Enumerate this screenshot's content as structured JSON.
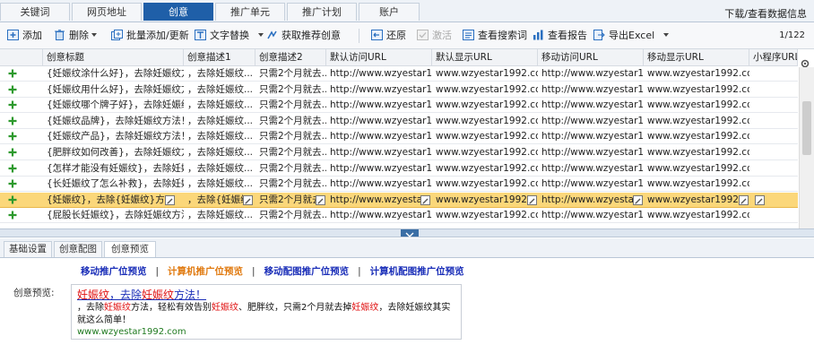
{
  "tabs": [
    "关键词",
    "网页地址",
    "创意",
    "推广单元",
    "推广计划",
    "账户"
  ],
  "active_tab": "创意",
  "top_right": "下载/查看数据信息",
  "toolbar": {
    "add": "添加",
    "delete": "删除",
    "batch": "批量添加/更新",
    "replace": "文字替换",
    "recommend": "获取推荐创意",
    "restore": "还原",
    "activate": "激活",
    "view_search": "查看搜索词",
    "view_report": "查看报告",
    "export": "导出Excel",
    "pager": "1/122"
  },
  "columns": [
    "创意标题",
    "创意描述1",
    "创意描述2",
    "默认访问URL",
    "默认显示URL",
    "移动访问URL",
    "移动显示URL",
    "小程序URL"
  ],
  "rows": [
    {
      "title": "{妊娠纹涂什么好}，去除妊娠纹方...",
      "d1": "，去除妊娠纹...",
      "d2": "只需2个月就去...",
      "u1": "http://www.wzyestar19...",
      "u2": "www.wzyestar1992.com",
      "u3": "http://www.wzyestar19...",
      "u4": "www.wzyestar1992.com"
    },
    {
      "title": "{妊娠纹用什么好}，去除妊娠纹方...",
      "d1": "，去除妊娠纹...",
      "d2": "只需2个月就去...",
      "u1": "http://www.wzyestar19...",
      "u2": "www.wzyestar1992.com",
      "u3": "http://www.wzyestar19...",
      "u4": "www.wzyestar1992.com"
    },
    {
      "title": "{妊娠纹哪个牌子好}，去除妊娠纹...",
      "d1": "，去除妊娠纹...",
      "d2": "只需2个月就去...",
      "u1": "http://www.wzyestar19...",
      "u2": "www.wzyestar1992.com",
      "u3": "http://www.wzyestar19...",
      "u4": "www.wzyestar1992.com"
    },
    {
      "title": "{妊娠纹品牌}，去除妊娠纹方法！",
      "d1": "，去除妊娠纹...",
      "d2": "只需2个月就去...",
      "u1": "http://www.wzyestar19...",
      "u2": "www.wzyestar1992.com",
      "u3": "http://www.wzyestar19...",
      "u4": "www.wzyestar1992.com"
    },
    {
      "title": "{妊娠纹产品}，去除妊娠纹方法！",
      "d1": "，去除妊娠纹...",
      "d2": "只需2个月就去...",
      "u1": "http://www.wzyestar19...",
      "u2": "www.wzyestar1992.com",
      "u3": "http://www.wzyestar19...",
      "u4": "www.wzyestar1992.com"
    },
    {
      "title": "{肥胖纹如何改善}，去除妊娠纹方...",
      "d1": "，去除妊娠纹...",
      "d2": "只需2个月就去...",
      "u1": "http://www.wzyestar19...",
      "u2": "www.wzyestar1992.com",
      "u3": "http://www.wzyestar19...",
      "u4": "www.wzyestar1992.com"
    },
    {
      "title": "{怎样才能没有妊娠纹}，去除妊娠...",
      "d1": "，去除妊娠纹...",
      "d2": "只需2个月就去...",
      "u1": "http://www.wzyestar19...",
      "u2": "www.wzyestar1992.com",
      "u3": "http://www.wzyestar19...",
      "u4": "www.wzyestar1992.com"
    },
    {
      "title": "{长妊娠纹了怎么补救}，去除妊娠...",
      "d1": "，去除妊娠纹...",
      "d2": "只需2个月就去...",
      "u1": "http://www.wzyestar19...",
      "u2": "www.wzyestar1992.com",
      "u3": "http://www.wzyestar19...",
      "u4": "www.wzyestar1992.com"
    },
    {
      "title": "{妊娠纹}，去除{妊娠纹}方法！",
      "d1": "，去除{妊娠纹",
      "d2": "只需2个月就去",
      "u1": "http://www.wzyestar19...",
      "u2": "www.wzyestar1992.com",
      "u3": "http://www.wzyestar19...",
      "u4": "www.wzyestar1992.com"
    },
    {
      "title": "{屁股长妊娠纹}，去除妊娠纹方法！",
      "d1": "，去除妊娠纹...",
      "d2": "只需2个月就去...",
      "u1": "http://www.wzyestar19...",
      "u2": "www.wzyestar1992.com",
      "u3": "http://www.wzyestar19...",
      "u4": "www.wzyestar1992.com"
    }
  ],
  "bottom_tabs": [
    "基础设置",
    "创意配图",
    "创意预览"
  ],
  "preview_links": [
    "移动推广位预览",
    "计算机推广位预览",
    "移动配图推广位预览",
    "计算机配图推广位预览"
  ],
  "preview_label": "创意预览:",
  "preview": {
    "title_a": "妊娠纹",
    "title_b": "，去除",
    "title_c": "妊娠纹",
    "title_d": "方法！",
    "desc_1": "，去除",
    "desc_2": "妊娠纹",
    "desc_3": "方法，轻松有效告别",
    "desc_4": "妊娠纹",
    "desc_5": "、肥胖纹，只需2个月就去掉",
    "desc_6": "妊娠纹",
    "desc_7": "，去除妊娠纹其实就这么简单！",
    "url": "www.wzyestar1992.com"
  }
}
